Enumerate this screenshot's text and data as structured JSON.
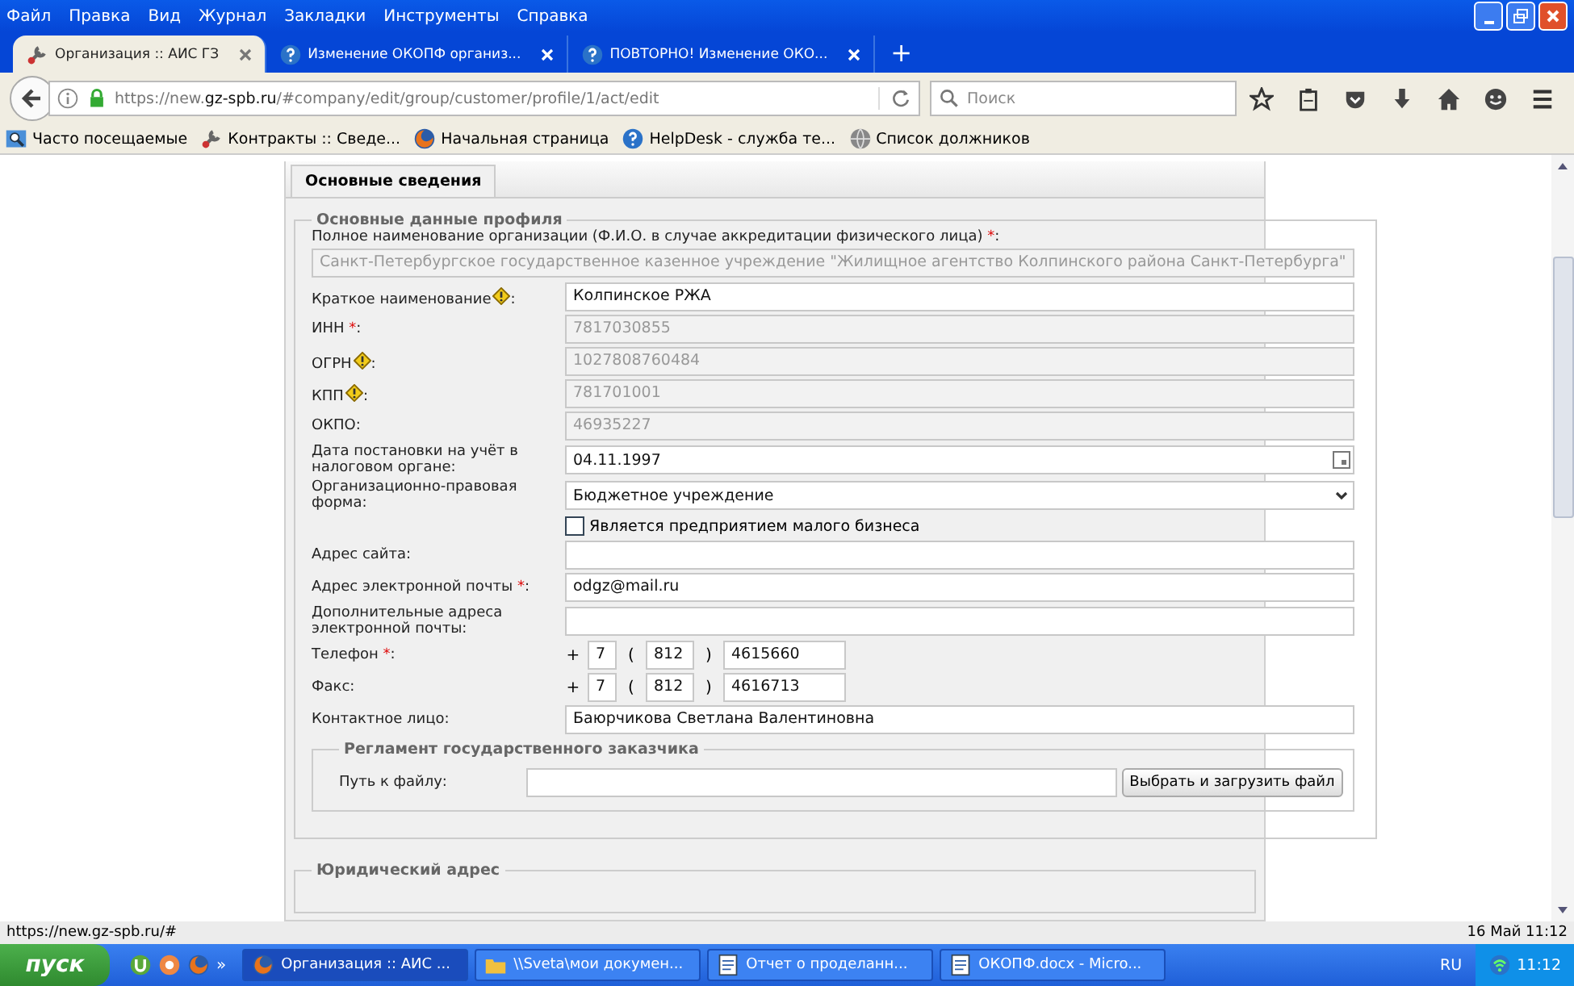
{
  "menu": [
    "Файл",
    "Правка",
    "Вид",
    "Журнал",
    "Закладки",
    "Инструменты",
    "Справка"
  ],
  "tabs": [
    {
      "label": "Организация :: АИС ГЗ",
      "selected": true,
      "kind": "tools"
    },
    {
      "label": "Изменение ОКОПФ организ...",
      "selected": false,
      "kind": "help"
    },
    {
      "label": "ПОВТОРНО! Изменение ОКО...",
      "selected": false,
      "kind": "help"
    }
  ],
  "new_tab": "+",
  "url": {
    "prefix": "https://new.",
    "host": "gz-spb.ru",
    "path": "/#company/edit/group/customer/profile/1/act/edit"
  },
  "search": {
    "placeholder": "Поиск"
  },
  "bookmarks": [
    {
      "label": "Часто посещаемые",
      "kind": "search"
    },
    {
      "label": "Контракты :: Сведе...",
      "kind": "tools"
    },
    {
      "label": "Начальная страница",
      "kind": "fox"
    },
    {
      "label": "HelpDesk - служба те...",
      "kind": "help"
    },
    {
      "label": "Список должников",
      "kind": "globe"
    }
  ],
  "page_tabs": [
    {
      "label": "Основные сведения",
      "selected": true
    }
  ],
  "section": {
    "legend": "Основные данные профиля",
    "fields": [
      {
        "kind": "wide",
        "label": "Полное наименование организации (Ф.И.О. в случае аккредитации физического лица) ",
        "star": "*",
        "tail": ":",
        "value": "Санкт-Петербургское государственное казенное учреждение \"Жилищное агентство Колпинского района Санкт-Петербурга\"",
        "disabled": true
      },
      {
        "kind": "text",
        "label": "Краткое наименование",
        "hint": true,
        "tail": ":",
        "value": "Колпинское РЖА",
        "disabled": false
      },
      {
        "kind": "text",
        "label": "ИНН ",
        "star": "*",
        "tail": ":",
        "value": "7817030855",
        "disabled": true
      },
      {
        "kind": "text",
        "label": "ОГРН",
        "hint": true,
        "tail": ":",
        "value": "1027808760484",
        "disabled": true
      },
      {
        "kind": "text",
        "label": "КПП",
        "hint": true,
        "tail": ":",
        "value": "781701001",
        "disabled": true
      },
      {
        "kind": "text",
        "label": "ОКПО:",
        "value": "46935227",
        "disabled": true
      },
      {
        "kind": "date",
        "label": "Дата постановки на учёт в налоговом органе:",
        "value": "04.11.1997",
        "disabled": false
      },
      {
        "kind": "select",
        "label": "Организационно-правовая форма:",
        "value": "Бюджетное учреждение",
        "disabled": false
      },
      {
        "kind": "checkbox",
        "label": "Является предприятием малого бизнеса",
        "checked": false
      },
      {
        "kind": "text",
        "label": "Адрес сайта:",
        "disabled": false
      },
      {
        "kind": "text",
        "label": "Адрес электронной почты ",
        "star": "*",
        "tail": ":",
        "value": "odgz@mail.ru",
        "disabled": false
      },
      {
        "kind": "text",
        "label": "Дополнительные адреса электронной почты:",
        "disabled": false
      },
      {
        "kind": "phone",
        "label": "Телефон ",
        "star": "*",
        "tail": ":",
        "plus": "+",
        "country": "7",
        "open": "(",
        "code": "812",
        "close": ")",
        "number": "4615660"
      },
      {
        "kind": "phone",
        "label": "Факс:",
        "plus": "+",
        "country": "7",
        "open": "(",
        "code": "812",
        "close": ")",
        "number": "4616713"
      },
      {
        "kind": "text",
        "label": "Контактное лицо:",
        "value": "Баюрчикова Светлана Валентиновна",
        "disabled": false
      }
    ],
    "subsection": {
      "legend": "Регламент государственного заказчика",
      "label": "Путь к файлу:",
      "button": "Выбрать и загрузить файл"
    }
  },
  "next_section": {
    "legend": "Юридический адрес"
  },
  "status_url": "https://new.gz-spb.ru/#",
  "status_date": "16 Май 11:12",
  "taskbar": {
    "start": "пуск",
    "more": "»",
    "tasks": [
      {
        "label": "Организация :: АИС ...",
        "kind": "fox",
        "selected": true
      },
      {
        "label": "\\\\Sveta\\мои докумен...",
        "kind": "folder",
        "selected": false
      },
      {
        "label": "Отчет о проделанн...",
        "kind": "doc",
        "selected": false
      },
      {
        "label": "ОКОПФ.docx - Micro...",
        "kind": "doc",
        "selected": false
      }
    ],
    "lang": "RU",
    "time": "11:12"
  }
}
